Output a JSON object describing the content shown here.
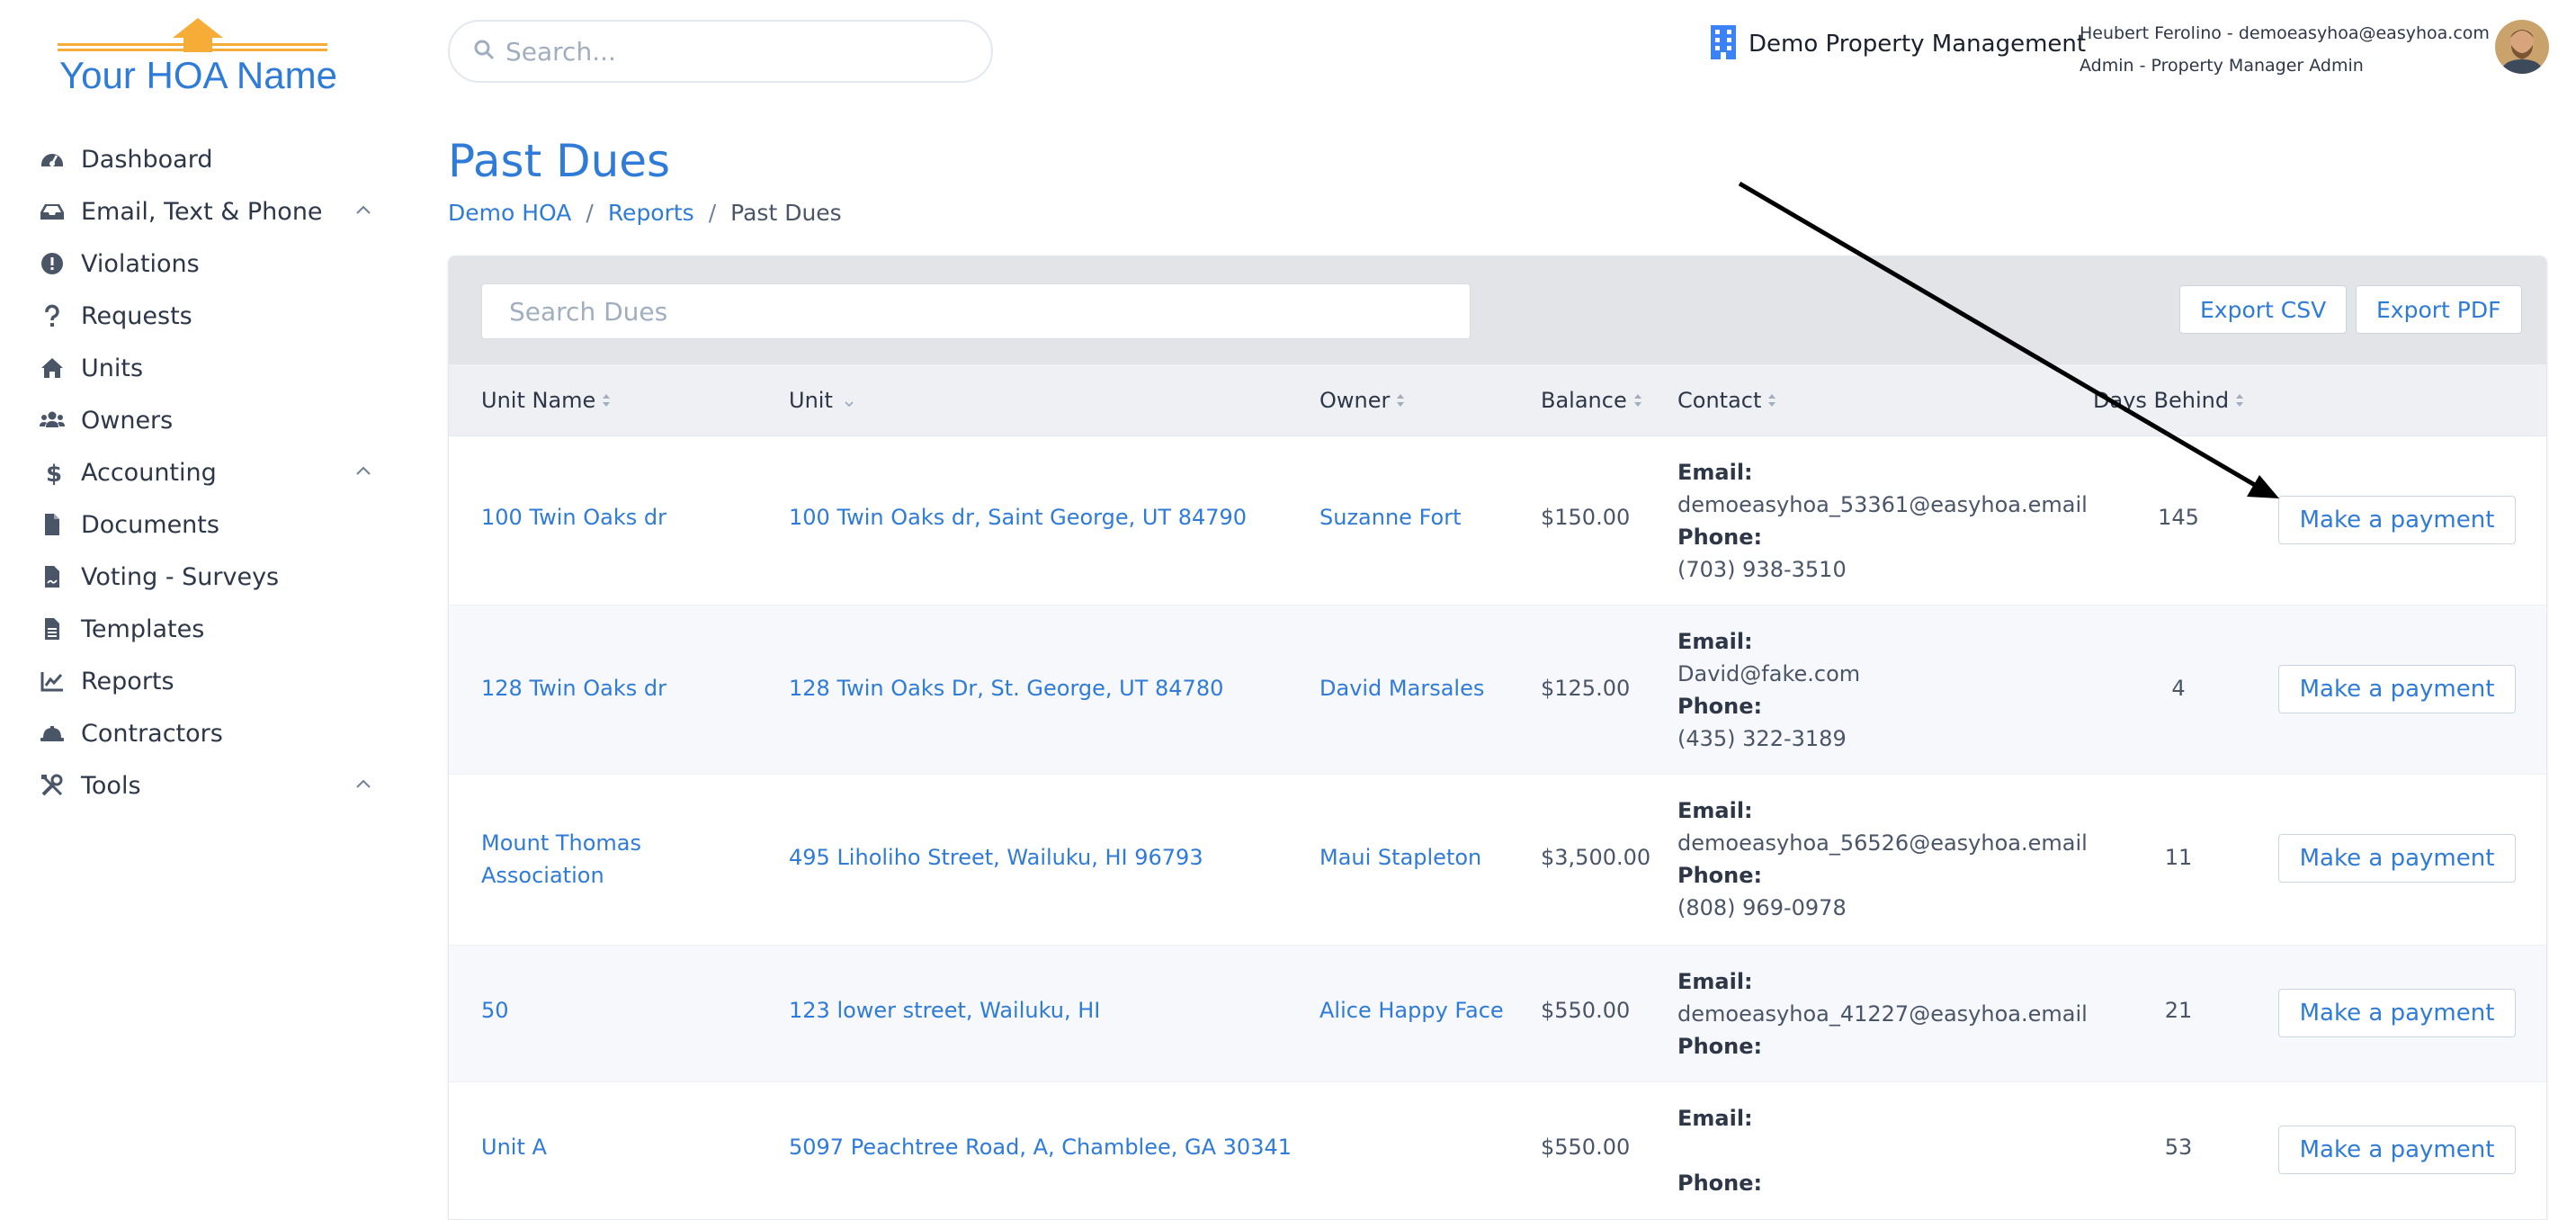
{
  "brand": {
    "logo_text": "Your HOA Name",
    "logo_color": "#2f7bd8",
    "logo_accent": "#f6ad37"
  },
  "sidebar": {
    "items": [
      {
        "label": "Dashboard",
        "icon": "gauge-icon",
        "expandable": false
      },
      {
        "label": "Email, Text & Phone",
        "icon": "inbox-icon",
        "expandable": true
      },
      {
        "label": "Violations",
        "icon": "exclamation-circle-icon",
        "expandable": false
      },
      {
        "label": "Requests",
        "icon": "question-icon",
        "expandable": false
      },
      {
        "label": "Units",
        "icon": "home-icon",
        "expandable": false
      },
      {
        "label": "Owners",
        "icon": "users-icon",
        "expandable": false
      },
      {
        "label": "Accounting",
        "icon": "dollar-icon",
        "expandable": true
      },
      {
        "label": "Documents",
        "icon": "file-icon",
        "expandable": false
      },
      {
        "label": "Voting - Surveys",
        "icon": "file-signature-icon",
        "expandable": false
      },
      {
        "label": "Templates",
        "icon": "file-alt-icon",
        "expandable": false
      },
      {
        "label": "Reports",
        "icon": "chart-line-icon",
        "expandable": false
      },
      {
        "label": "Contractors",
        "icon": "hard-hat-icon",
        "expandable": false
      },
      {
        "label": "Tools",
        "icon": "tools-icon",
        "expandable": true
      }
    ]
  },
  "topbar": {
    "search_placeholder": "Search...",
    "company": "Demo Property Management",
    "user_name": "Heubert Ferolino - demoeasyhoa@easyhoa.com",
    "user_role": "Admin - Property Manager Admin"
  },
  "page": {
    "title": "Past Dues",
    "breadcrumb": [
      "Demo HOA",
      "Reports",
      "Past Dues"
    ]
  },
  "toolbar": {
    "search_placeholder": "Search Dues",
    "export_csv": "Export CSV",
    "export_pdf": "Export PDF"
  },
  "table": {
    "columns": [
      "Unit Name",
      "Unit",
      "Owner",
      "Balance",
      "Contact",
      "Days Behind"
    ],
    "email_label": "Email:",
    "phone_label": "Phone:",
    "action_label": "Make a payment",
    "rows": [
      {
        "unit_name": "100 Twin Oaks dr",
        "unit": "100 Twin Oaks dr, Saint George, UT 84790",
        "owner": "Suzanne Fort",
        "balance": "$150.00",
        "email": "demoeasyhoa_53361@easyhoa.email",
        "phone": "(703) 938-3510",
        "days": "145"
      },
      {
        "unit_name": "128 Twin Oaks dr",
        "unit": "128 Twin Oaks Dr, St. George, UT 84780",
        "owner": "David Marsales",
        "balance": "$125.00",
        "email": "David@fake.com",
        "phone": "(435) 322-3189",
        "days": "4"
      },
      {
        "unit_name_line1": "Mount Thomas",
        "unit_name_line2": "Association",
        "unit": "495 Liholiho Street, Wailuku, HI 96793",
        "owner": "Maui Stapleton",
        "balance": "$3,500.00",
        "email": "demoeasyhoa_56526@easyhoa.email",
        "phone": "(808) 969-0978",
        "days": "11"
      },
      {
        "unit_name": "50",
        "unit": "123 lower street, Wailuku, HI",
        "owner": "Alice Happy Face",
        "balance": "$550.00",
        "email": "demoeasyhoa_41227@easyhoa.email",
        "phone": "",
        "days": "21"
      },
      {
        "unit_name": "Unit A",
        "unit": "5097 Peachtree Road, A, Chamblee, GA 30341",
        "owner": "",
        "balance": "$550.00",
        "email": "",
        "phone": "",
        "days": "53"
      }
    ]
  }
}
